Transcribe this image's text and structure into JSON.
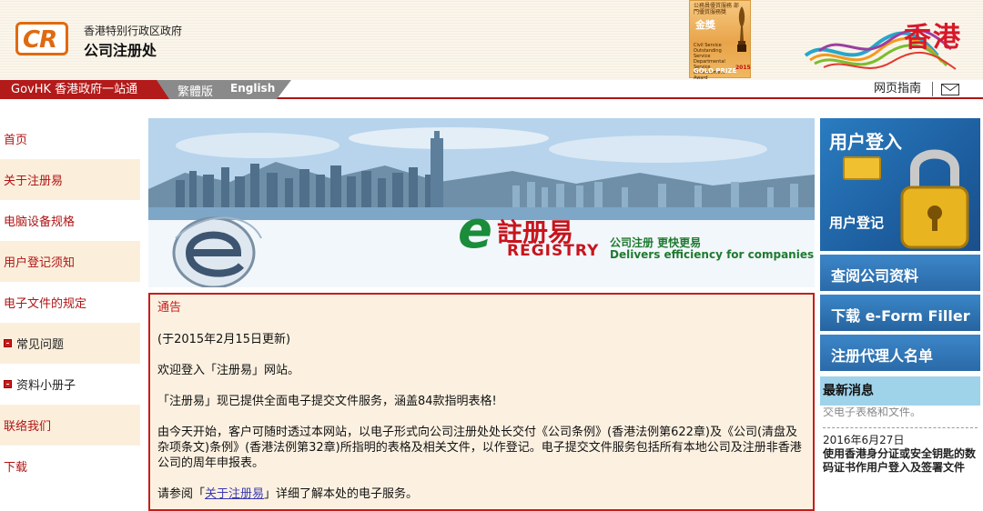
{
  "header": {
    "logo_text": "CR",
    "gov_name": "香港特别行政区政府",
    "office_name": "公司注册处",
    "award": {
      "line1": "公務員優質服務 部門優質服務獎",
      "gold_cn": "金獎",
      "en": "Civil Service Outstanding Service Departmental Service Enhancement Award",
      "prize": "GOLD PRIZE",
      "year": "2015"
    },
    "brand_hk": "香港"
  },
  "nav": {
    "govhk": "GovHK 香港政府一站通",
    "lang_trad": "繁體版",
    "lang_en": "English",
    "guide": "网页指南",
    "mail_icon": "mail-icon"
  },
  "sidebar": {
    "items": [
      {
        "label": "首页"
      },
      {
        "label": "关于注册易"
      },
      {
        "label": "电脑设备规格"
      },
      {
        "label": "用户登记须知"
      },
      {
        "label": "电子文件的规定"
      },
      {
        "label": "常见问题"
      },
      {
        "label": "资料小册子"
      },
      {
        "label": "联络我们"
      },
      {
        "label": "下载"
      }
    ]
  },
  "banner": {
    "registry_e": "e",
    "registry_cn": "註册易",
    "registry_en": "REGISTRY",
    "slogan_cn": "公司注册  更快更易",
    "slogan_en": "Delivers efficiency for companies"
  },
  "notice": {
    "title": "通告",
    "updated": "(于2015年2月15日更新)",
    "p1": "欢迎登入「注册易」网站。",
    "p2": "「注册易」现已提供全面电子提交文件服务，涵盖84款指明表格!",
    "p3": "由今天开始，客户可随时透过本网站，以电子形式向公司注册处处长交付《公司条例》(香港法例第622章)及《公司(清盘及杂项条文)条例》(香港法例第32章)所指明的表格及相关文件，以作登记。电子提交文件服务包括所有本地公司及注册非香港公司的周年申报表。",
    "p4_prefix": "请参阅「",
    "p4_link": "关于注册易",
    "p4_suffix": "」详细了解本处的电子服务。"
  },
  "right": {
    "login_title": "用户登入",
    "login_sub": "用户登记",
    "search": "查阅公司资料",
    "eform": "下载 e-Form Filler",
    "agent": "注册代理人名单",
    "news_head": "最新消息",
    "news_clip": "交电子表格和文件。",
    "news_date": "2016年6月27日",
    "news_text": "使用香港身分证或安全钥匙的数码证书作用户登入及签署文件"
  },
  "colors": {
    "brand_red": "#b31a1a",
    "link_red": "#b01515",
    "panel_blue": "#2b6aa8",
    "notice_bg": "#fcf1e1"
  }
}
